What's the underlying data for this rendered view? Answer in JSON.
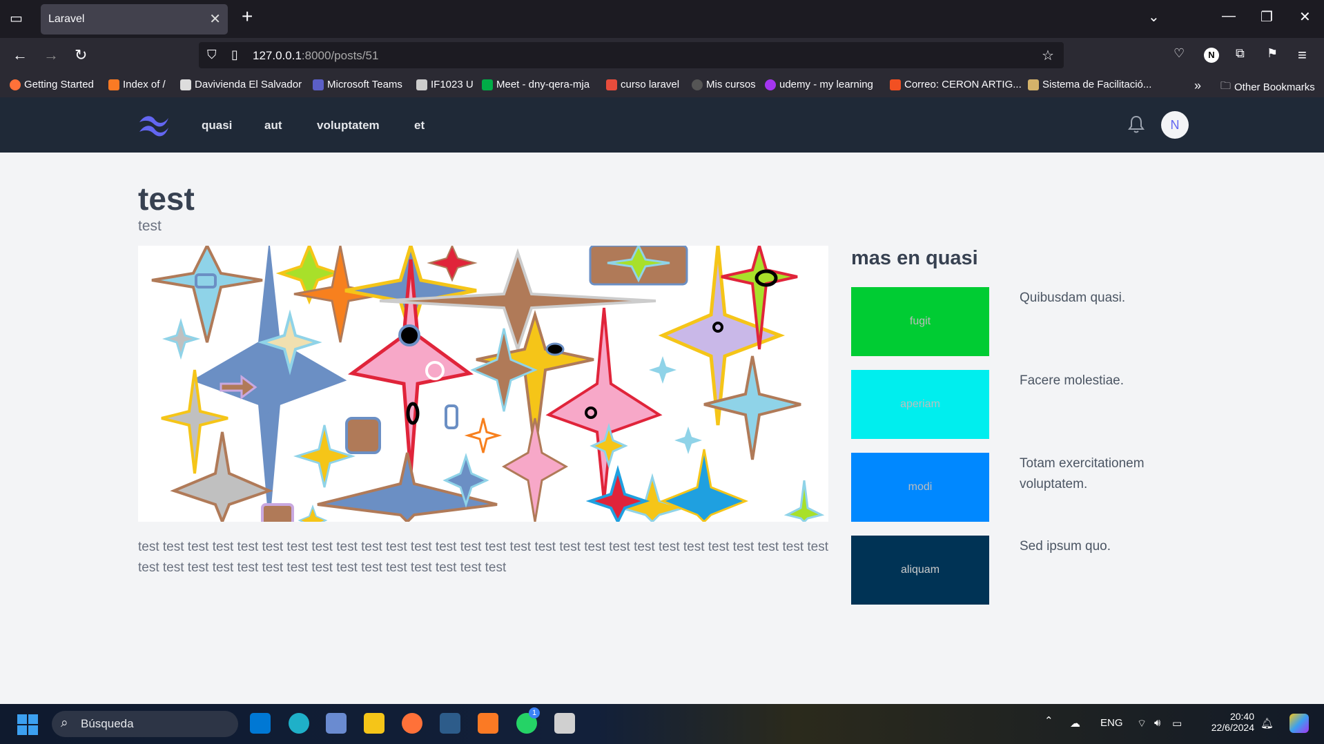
{
  "browser": {
    "tab_title": "Laravel",
    "tab_close": "✕",
    "new_tab": "+",
    "url_host": "127.0.0.1",
    "url_rest": ":8000/posts/51",
    "bookmarks": [
      {
        "label": "Getting Started",
        "color": "#ff7139"
      },
      {
        "label": "Index of /",
        "color": "#fb7a24"
      },
      {
        "label": "Davivienda El Salvador",
        "color": "#dddddd"
      },
      {
        "label": "Microsoft Teams",
        "color": "#5b5fc7"
      },
      {
        "label": "IF1023 U",
        "color": "#cccccc"
      },
      {
        "label": "Meet - dny-qera-mja",
        "color": "#00ac47"
      },
      {
        "label": "curso laravel",
        "color": "#e74c3c"
      },
      {
        "label": "Mis cursos",
        "color": "#555555"
      },
      {
        "label": "udemy - my learning",
        "color": "#a435f0"
      },
      {
        "label": "Correo: CERON ARTIG...",
        "color": "#f25022"
      },
      {
        "label": "Sistema de Facilitació...",
        "color": "#d4b26a"
      }
    ],
    "other_bookmarks": "Other Bookmarks"
  },
  "app": {
    "nav": [
      "quasi",
      "aut",
      "voluptatem",
      "et"
    ],
    "avatar_initial": "N",
    "accent": "#6366f1"
  },
  "post": {
    "title": "test",
    "subtitle": "test",
    "body": "test test test test test test test test test test test test test test test test test test test test test test test test test test test test test test test test test test test test test test test test test test test"
  },
  "related": {
    "heading": "mas en quasi",
    "items": [
      {
        "thumb_text": "fugit",
        "title": "Quibusdam quasi.",
        "color": "#00cc33"
      },
      {
        "thumb_text": "aperiam",
        "title": "Facere molestiae.",
        "color": "#00eeee"
      },
      {
        "thumb_text": "modi",
        "title": "Totam exercitationem voluptatem.",
        "color": "#0088ff"
      },
      {
        "thumb_text": "aliquam",
        "title": "Sed ipsum quo.",
        "color": "#003355"
      }
    ]
  },
  "taskbar": {
    "search_placeholder": "Búsqueda",
    "lang": "ENG",
    "time": "20:40",
    "date": "22/6/2024",
    "whatsapp_badge": "1"
  }
}
